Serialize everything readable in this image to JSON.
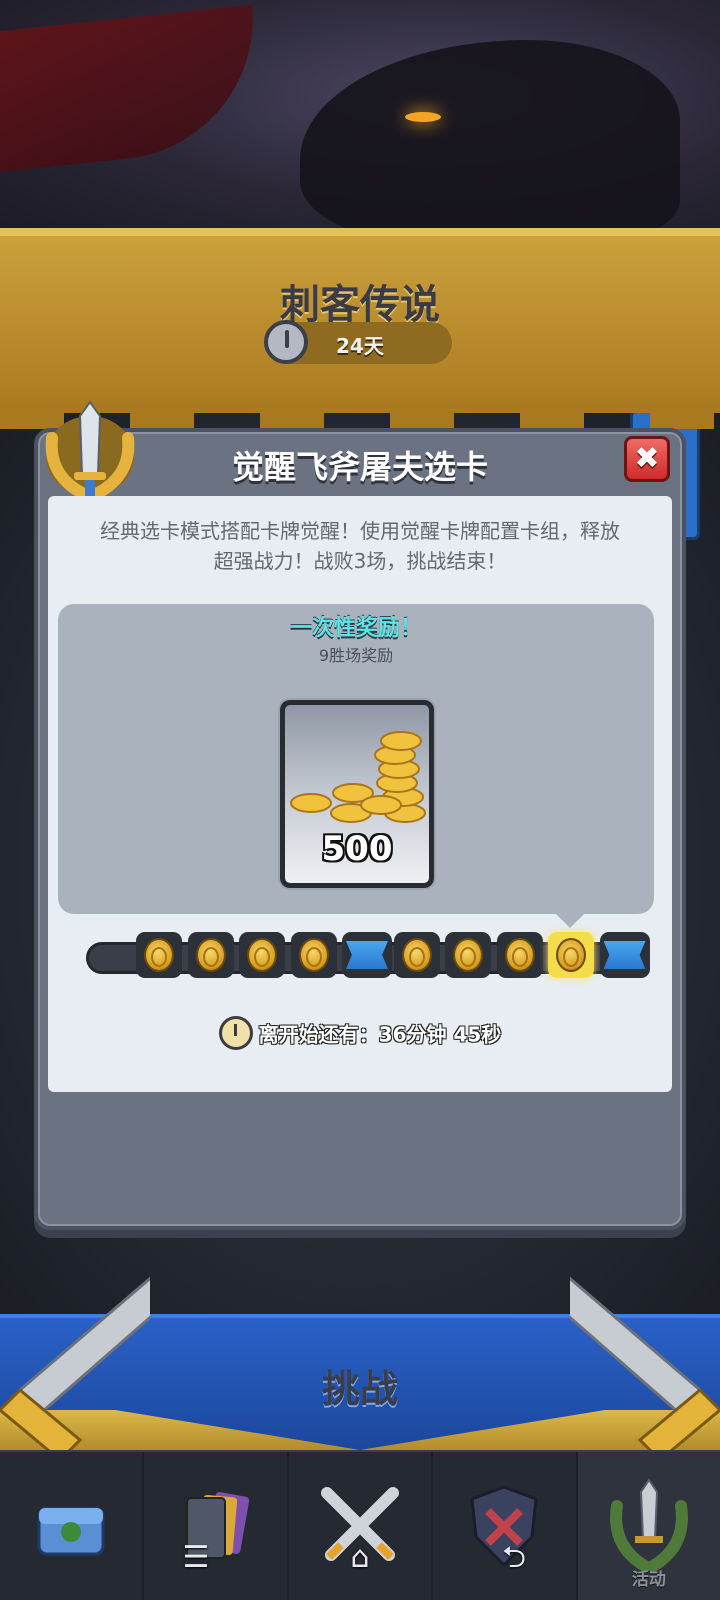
{
  "event": {
    "title": "刺客传说",
    "remaining": "24天"
  },
  "modal": {
    "title": "觉醒飞斧屠夫选卡",
    "close_icon": "✖",
    "description_line1": "经典选卡模式搭配卡牌觉醒！使用觉醒卡牌配置卡组，释放",
    "description_line2": "超强战力！战败3场，挑战结束！",
    "reward": {
      "title": "一次性奖励！",
      "subtitle": "9胜场奖励",
      "amount": "500"
    },
    "progress": {
      "nodes": [
        "coin",
        "coin",
        "coin",
        "coin",
        "ribbon",
        "coin",
        "coin",
        "coin",
        "coin",
        "ribbon"
      ],
      "current_index": 8
    },
    "countdown": {
      "label": "离开始还有：",
      "time": "36分钟  45秒"
    }
  },
  "challenge_button": {
    "label": "挑战"
  },
  "bottom_nav": {
    "items": [
      {
        "name": "chest",
        "label": ""
      },
      {
        "name": "cards",
        "label": ""
      },
      {
        "name": "battle",
        "label": ""
      },
      {
        "name": "clan",
        "label": ""
      },
      {
        "name": "events",
        "label": "活动"
      }
    ]
  },
  "system_nav": {
    "menu_icon": "☰",
    "home_icon": "⌂",
    "back_icon": "⮌"
  },
  "colors": {
    "accent_gold": "#caa13b",
    "modal_bg": "#6b7282",
    "challenge_blue": "#2a61c8",
    "close_red": "#cf2a29",
    "reward_cyan": "#5ee3e6"
  }
}
